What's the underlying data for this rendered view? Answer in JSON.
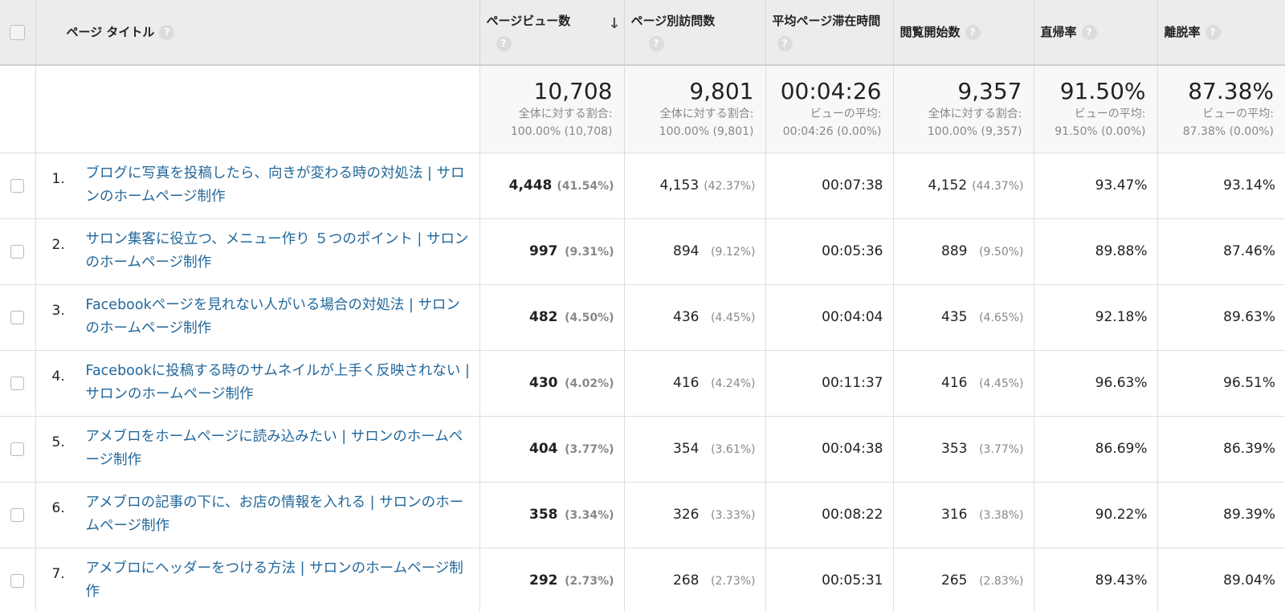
{
  "columns": {
    "title": "ページ タイトル",
    "pageviews": "ページビュー数",
    "unique": "ページ別訪問数",
    "avg_time": "平均ページ滞在時間",
    "entrances": "閲覧開始数",
    "bounce": "直帰率",
    "exit": "離脱率",
    "help": "?",
    "sort_arrow": "↓"
  },
  "totals": {
    "pageviews": {
      "value": "10,708",
      "label": "全体に対する割合:",
      "detail": "100.00% (10,708)"
    },
    "unique": {
      "value": "9,801",
      "label": "全体に対する割合:",
      "detail": "100.00% (9,801)"
    },
    "avg_time": {
      "value": "00:04:26",
      "label": "ビューの平均:",
      "detail": "00:04:26 (0.00%)"
    },
    "entrances": {
      "value": "9,357",
      "label": "全体に対する割合:",
      "detail": "100.00% (9,357)"
    },
    "bounce": {
      "value": "91.50%",
      "label": "ビューの平均:",
      "detail": "91.50% (0.00%)"
    },
    "exit": {
      "value": "87.38%",
      "label": "ビューの平均:",
      "detail": "87.38% (0.00%)"
    }
  },
  "rows": [
    {
      "num": "1.",
      "title": "ブログに写真を投稿したら、向きが変わる時の対処法 | サロンのホームページ制作",
      "pv": "4,448",
      "pv_pct": "(41.54%)",
      "uv": "4,153",
      "uv_pct": "(42.37%)",
      "time": "00:07:38",
      "ent": "4,152",
      "ent_pct": "(44.37%)",
      "bounce": "93.47%",
      "exit": "93.14%"
    },
    {
      "num": "2.",
      "title": "サロン集客に役立つ、メニュー作り ５つのポイント | サロンのホームページ制作",
      "pv": "997",
      "pv_pct": "(9.31%)",
      "uv": "894",
      "uv_pct": "(9.12%)",
      "time": "00:05:36",
      "ent": "889",
      "ent_pct": "(9.50%)",
      "bounce": "89.88%",
      "exit": "87.46%"
    },
    {
      "num": "3.",
      "title": "Facebookページを見れない人がいる場合の対処法 | サロンのホームページ制作",
      "pv": "482",
      "pv_pct": "(4.50%)",
      "uv": "436",
      "uv_pct": "(4.45%)",
      "time": "00:04:04",
      "ent": "435",
      "ent_pct": "(4.65%)",
      "bounce": "92.18%",
      "exit": "89.63%"
    },
    {
      "num": "4.",
      "title": "Facebookに投稿する時のサムネイルが上手く反映されない | サロンのホームページ制作",
      "pv": "430",
      "pv_pct": "(4.02%)",
      "uv": "416",
      "uv_pct": "(4.24%)",
      "time": "00:11:37",
      "ent": "416",
      "ent_pct": "(4.45%)",
      "bounce": "96.63%",
      "exit": "96.51%"
    },
    {
      "num": "5.",
      "title": "アメブロをホームページに読み込みたい | サロンのホームページ制作",
      "pv": "404",
      "pv_pct": "(3.77%)",
      "uv": "354",
      "uv_pct": "(3.61%)",
      "time": "00:04:38",
      "ent": "353",
      "ent_pct": "(3.77%)",
      "bounce": "86.69%",
      "exit": "86.39%"
    },
    {
      "num": "6.",
      "title": "アメブロの記事の下に、お店の情報を入れる | サロンのホームページ制作",
      "pv": "358",
      "pv_pct": "(3.34%)",
      "uv": "326",
      "uv_pct": "(3.33%)",
      "time": "00:08:22",
      "ent": "316",
      "ent_pct": "(3.38%)",
      "bounce": "90.22%",
      "exit": "89.39%"
    },
    {
      "num": "7.",
      "title": "アメブロにヘッダーをつける方法 | サロンのホームページ制作",
      "pv": "292",
      "pv_pct": "(2.73%)",
      "uv": "268",
      "uv_pct": "(2.73%)",
      "time": "00:05:31",
      "ent": "265",
      "ent_pct": "(2.83%)",
      "bounce": "89.43%",
      "exit": "89.04%"
    }
  ]
}
